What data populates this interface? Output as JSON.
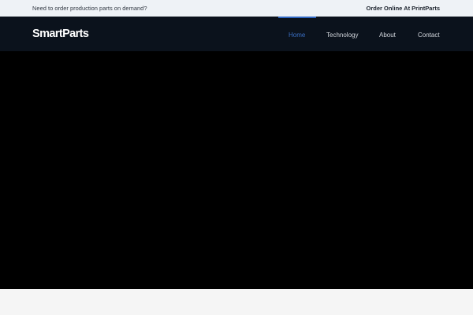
{
  "topbar": {
    "tagline": "Need to order production parts on demand?",
    "order_link": "Order Online At PrintParts"
  },
  "header": {
    "logo": "SmartParts",
    "nav": [
      {
        "label": "Home",
        "active": true
      },
      {
        "label": "Technology",
        "active": false
      },
      {
        "label": "About",
        "active": false
      },
      {
        "label": "Contact",
        "active": false
      }
    ]
  },
  "colors": {
    "topbar_bg": "#eef2f6",
    "navbar_bg": "#0b121c",
    "accent": "#2f67c2",
    "hero_bg": "#000000"
  }
}
